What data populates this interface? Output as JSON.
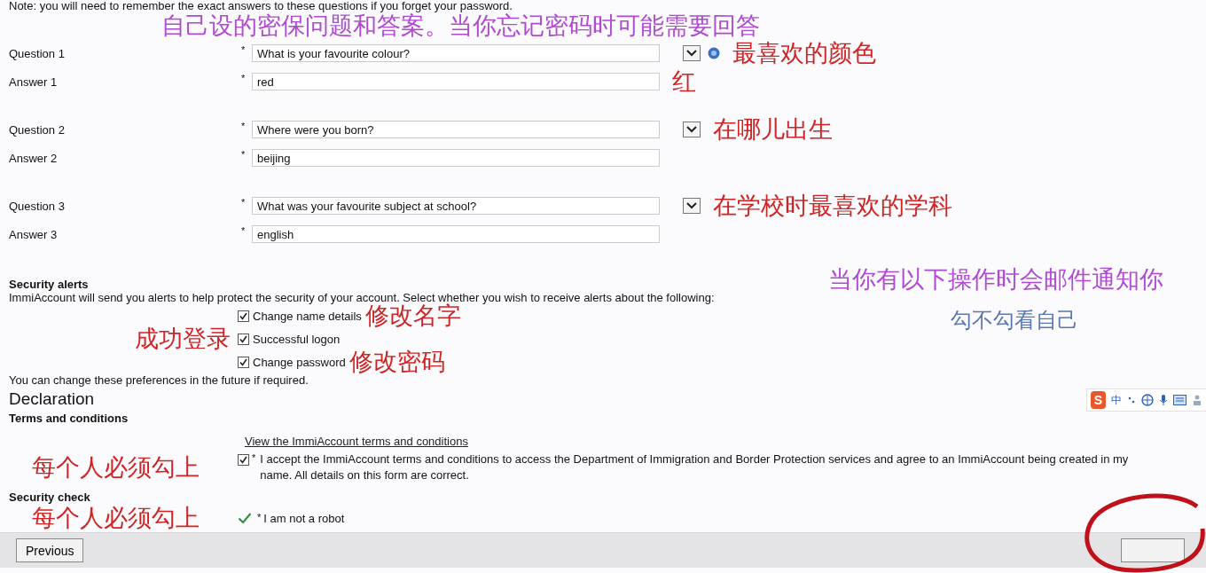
{
  "note": "Note: you will need to remember the exact answers to these questions if you forget your password.",
  "note_annotation": {
    "text": "自己设的密保问题和答案。当你忘记密码时可能需要回答",
    "color": "#b04ad0"
  },
  "question_groups": [
    {
      "rows": [
        {
          "kind": "select",
          "label": "Question 1",
          "marker": "*",
          "value": "What is your favourite colour?",
          "help": true,
          "annotation": {
            "text": "最喜欢的颜色",
            "color": "#d02424"
          }
        },
        {
          "kind": "text",
          "label": "Answer 1",
          "marker": "*",
          "value": "red",
          "annotation": {
            "text": "红",
            "color": "#d02424"
          }
        }
      ]
    },
    {
      "rows": [
        {
          "kind": "select",
          "label": "Question 2",
          "marker": "*",
          "value": "Where were you born?",
          "help": false,
          "annotation": {
            "text": "在哪儿出生",
            "color": "#d02424"
          }
        },
        {
          "kind": "text",
          "label": "Answer 2",
          "marker": "*",
          "value": "beijing"
        }
      ]
    },
    {
      "rows": [
        {
          "kind": "select",
          "label": "Question 3",
          "marker": "*",
          "value": "What was your favourite subject at school?",
          "help": false,
          "annotation": {
            "text": "在学校时最喜欢的学科",
            "color": "#d02424"
          }
        },
        {
          "kind": "text",
          "label": "Answer 3",
          "marker": "*",
          "value": "english"
        }
      ]
    }
  ],
  "security_alerts": {
    "title": "Security alerts",
    "annotation": {
      "text": "当你有以下操作时会邮件通知你",
      "color": "#b04ad0"
    },
    "description": "ImmiAccount will send you alerts to help protect the security of your account. Select whether you wish to receive alerts about the following:",
    "side_annotation": {
      "text": "勾不勾看自己",
      "color": "#5a78b4"
    },
    "options": [
      {
        "label": "Change name details",
        "checked": true,
        "annotation": {
          "text": "修改名字",
          "color": "#d02424"
        }
      },
      {
        "label": "Successful logon",
        "checked": true
      },
      {
        "label": "Change password",
        "checked": true,
        "annotation": {
          "text": "修改密码",
          "color": "#d02424"
        }
      }
    ],
    "left_annotation": {
      "text": "成功登录",
      "color": "#d02424"
    },
    "footnote": "You can change these preferences in the future if required."
  },
  "declaration": {
    "heading": "Declaration",
    "terms_title": "Terms and conditions",
    "terms_link": "View the ImmiAccount terms and conditions",
    "accept": {
      "checked": true,
      "marker": "*",
      "text": "I accept the ImmiAccount terms and conditions to access the Department of Immigration and Border Protection services and agree to an ImmiAccount being created in my name. All details on this form are correct.",
      "annotation": {
        "text": "每个人必须勾上",
        "color": "#d02424"
      }
    }
  },
  "security_check": {
    "title": "Security check",
    "checked": true,
    "marker": "*",
    "text": "I am not a robot",
    "annotation": {
      "text": "每个人必须勾上",
      "color": "#d02424"
    }
  },
  "ime_toolbar": {
    "logo": "S",
    "mode": "中"
  },
  "footer": {
    "previous": "Previous",
    "next_highlighted": true
  }
}
